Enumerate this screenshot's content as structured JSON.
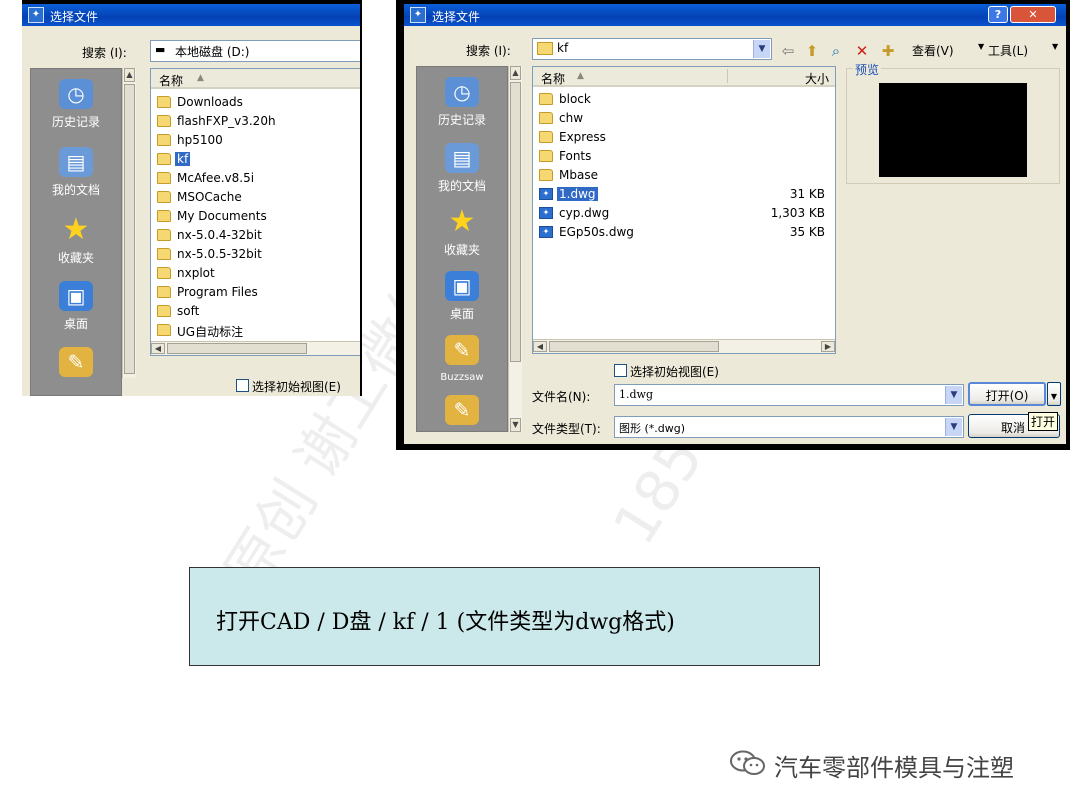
{
  "left_dialog": {
    "title": "选择文件",
    "search_label": "搜索 (I):",
    "search_value": "本地磁盘 (D:)",
    "places": [
      "历史记录",
      "我的文档",
      "收藏夹",
      "桌面"
    ],
    "column_name": "名称",
    "files": [
      {
        "name": "Downloads",
        "type": "folder"
      },
      {
        "name": "flashFXP_v3.20h",
        "type": "folder"
      },
      {
        "name": "hp5100",
        "type": "folder"
      },
      {
        "name": "kf",
        "type": "folder",
        "selected": true
      },
      {
        "name": "McAfee.v8.5i",
        "type": "folder"
      },
      {
        "name": "MSOCache",
        "type": "folder"
      },
      {
        "name": "My Documents",
        "type": "folder"
      },
      {
        "name": "nx-5.0.4-32bit",
        "type": "folder"
      },
      {
        "name": "nx-5.0.5-32bit",
        "type": "folder"
      },
      {
        "name": "nxplot",
        "type": "folder"
      },
      {
        "name": "Program Files",
        "type": "folder"
      },
      {
        "name": "soft",
        "type": "folder"
      },
      {
        "name": "UG自动标注",
        "type": "folder"
      }
    ],
    "initial_view_checkbox": "选择初始视图(E)"
  },
  "right_dialog": {
    "title": "选择文件",
    "search_label": "搜索 (I):",
    "search_value": "kf",
    "view_label": "查看(V)",
    "tools_label": "工具(L)",
    "places": [
      "历史记录",
      "我的文档",
      "收藏夹",
      "桌面",
      "Buzzsaw"
    ],
    "column_name": "名称",
    "column_size": "大小",
    "files": [
      {
        "name": "block",
        "type": "folder",
        "size": ""
      },
      {
        "name": "chw",
        "type": "folder",
        "size": ""
      },
      {
        "name": "Express",
        "type": "folder",
        "size": ""
      },
      {
        "name": "Fonts",
        "type": "folder",
        "size": ""
      },
      {
        "name": "Mbase",
        "type": "folder",
        "size": ""
      },
      {
        "name": "1.dwg",
        "type": "dwg",
        "size": "31 KB",
        "selected": true
      },
      {
        "name": "cyp.dwg",
        "type": "dwg",
        "size": "1,303 KB"
      },
      {
        "name": "EGp50s.dwg",
        "type": "dwg",
        "size": "35 KB"
      }
    ],
    "preview_label": "预览",
    "initial_view_checkbox": "选择初始视图(E)",
    "filename_label": "文件名(N):",
    "filename_value": "1.dwg",
    "filetype_label": "文件类型(T):",
    "filetype_value": "图形 (*.dwg)",
    "open_button": "打开(O)",
    "cancel_button": "取消",
    "tooltip": "打开"
  },
  "caption": "打开CAD / D盘 / kf / 1 (文件类型为dwg格式)",
  "brand": "汽车零部件模具与注塑",
  "colors": {
    "caption_bg": "#cbe8ea",
    "titlebar": "#0a53cf",
    "places_bg": "#8e8e8e",
    "selection": "#316ac5"
  }
}
